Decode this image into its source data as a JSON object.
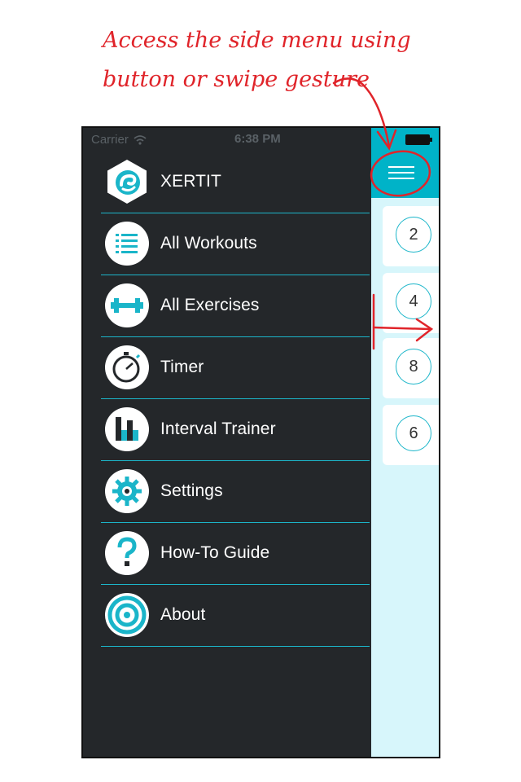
{
  "annotation": {
    "line1": "Access the side menu using",
    "line2": "button or swipe gesture"
  },
  "status_bar": {
    "carrier": "Carrier",
    "time": "6:38 PM"
  },
  "menu": {
    "items": [
      {
        "label": "XERTIT",
        "icon": "xertit-logo-icon"
      },
      {
        "label": "All Workouts",
        "icon": "list-icon"
      },
      {
        "label": "All Exercises",
        "icon": "dumbbell-icon"
      },
      {
        "label": "Timer",
        "icon": "stopwatch-icon"
      },
      {
        "label": "Interval Trainer",
        "icon": "bar-chart-icon"
      },
      {
        "label": "Settings",
        "icon": "gear-icon"
      },
      {
        "label": "How-To Guide",
        "icon": "question-icon"
      },
      {
        "label": "About",
        "icon": "target-icon"
      }
    ]
  },
  "content": {
    "cards": [
      "2",
      "4",
      "8",
      "6"
    ]
  },
  "colors": {
    "accent": "#00b3c8",
    "menu_bg": "#24272a",
    "annotation": "#e0242a",
    "content_bg": "#d7f6fb"
  }
}
